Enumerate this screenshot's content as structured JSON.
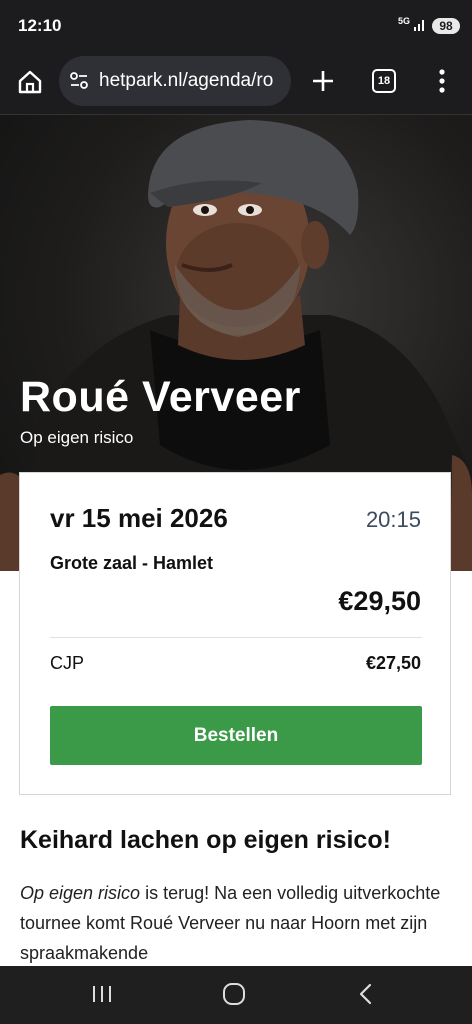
{
  "status_bar": {
    "time": "12:10",
    "network": "5G",
    "battery": "98"
  },
  "browser": {
    "url": "hetpark.nl/agenda/ro",
    "tab_count": "18"
  },
  "hero": {
    "title": "Roué Verveer",
    "subtitle": "Op eigen risico"
  },
  "ticket": {
    "date": "vr 15 mei 2026",
    "time": "20:15",
    "venue": "Grote zaal - Hamlet",
    "price": "€29,50",
    "discount_label": "CJP",
    "discount_price": "€27,50",
    "order_label": "Bestellen"
  },
  "article": {
    "headline": "Keihard lachen op eigen risico!",
    "intro_em": "Op eigen risico",
    "intro_rest": " is terug! Na een volledig uitverkochte tournee komt Roué Verveer nu naar Hoorn met zijn spraakmakende"
  },
  "colors": {
    "order_button": "#3a9a48",
    "time_text": "#3c4a5e",
    "system_bars": "#1c1c1e"
  },
  "icons": [
    "home-icon",
    "site-settings-icon",
    "plus-icon",
    "tab-switcher-icon",
    "more-vert-icon",
    "recents-icon",
    "nav-home-icon",
    "back-icon"
  ]
}
